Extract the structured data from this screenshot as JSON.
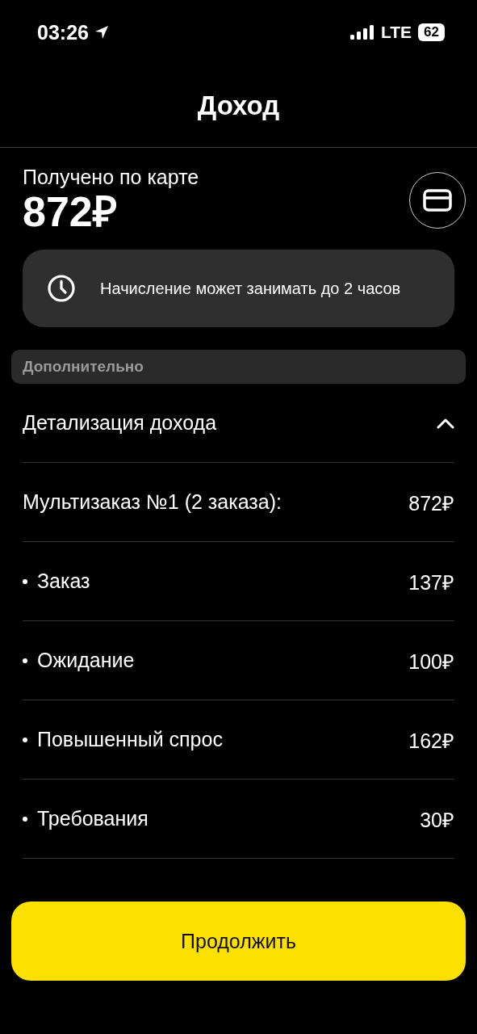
{
  "status_bar": {
    "time": "03:26",
    "network": "LTE",
    "battery": "62"
  },
  "title": "Доход",
  "received": {
    "label": "Получено по карте",
    "amount": "872₽"
  },
  "notice": {
    "text": "Начисление может занимать до 2 часов"
  },
  "section": {
    "title": "Дополнительно"
  },
  "details": {
    "title": "Детализация дохода",
    "expanded": true,
    "rows": [
      {
        "kind": "total",
        "label": "Мультизаказ №1 (2 заказа):",
        "value": "872₽"
      },
      {
        "kind": "item",
        "label": "Заказ",
        "value": "137₽"
      },
      {
        "kind": "item",
        "label": "Ожидание",
        "value": "100₽"
      },
      {
        "kind": "item",
        "label": "Повышенный спрос",
        "value": "162₽"
      },
      {
        "kind": "item",
        "label": "Требования",
        "value": "30₽"
      }
    ]
  },
  "button": {
    "label": "Продолжить"
  }
}
